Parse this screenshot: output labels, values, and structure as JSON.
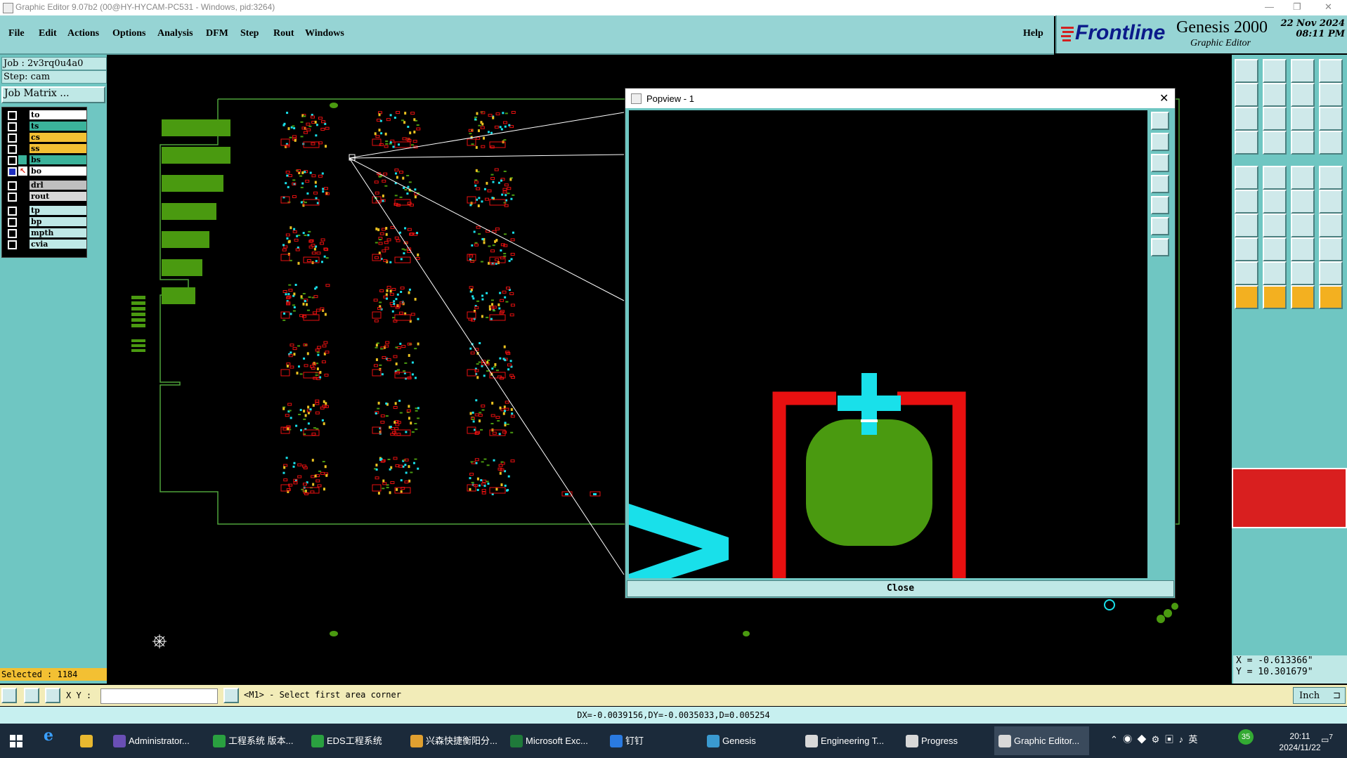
{
  "window": {
    "title": "Graphic Editor 9.07b2 (00@HY-HYCAM-PC531 - Windows, pid:3264)"
  },
  "menu": {
    "items": [
      "File",
      "Edit",
      "Actions",
      "Options",
      "Analysis",
      "DFM",
      "Step",
      "Rout",
      "Windows"
    ],
    "help": "Help"
  },
  "brand": {
    "logo": "Frontline",
    "product": "Genesis 2000",
    "subtitle": "Graphic Editor",
    "date": "22 Nov 2024",
    "time": "08:11 PM"
  },
  "job": {
    "job_label": "Job : 2v3rq0u4a0",
    "step_label": "Step: cam",
    "matrix_button": "Job Matrix ..."
  },
  "layers": [
    {
      "name": "to",
      "color": "#ffffff"
    },
    {
      "name": "ts",
      "color": "#3bb39b"
    },
    {
      "name": "cs",
      "color": "#f3c033"
    },
    {
      "name": "ss",
      "color": "#f3c033"
    },
    {
      "name": "bs",
      "color": "#3bb39b"
    },
    {
      "name": "bo",
      "color": "#ffffff"
    },
    {
      "name": "drl",
      "color": "#bfbfbf"
    },
    {
      "name": "rout",
      "color": "#d8d8d8"
    },
    {
      "name": "tp",
      "color": "#bfe8e6"
    },
    {
      "name": "bp",
      "color": "#bfe8e6"
    },
    {
      "name": "mpth",
      "color": "#bfe8e6"
    },
    {
      "name": "cvia",
      "color": "#bfe8e6"
    }
  ],
  "selected": "Selected : 1184",
  "popview": {
    "title": "Popview - 1",
    "close_label": "Close"
  },
  "coords": {
    "x": "X = -0.613366\"",
    "y": "Y = 10.301679\""
  },
  "status": {
    "xy_label": "X Y :",
    "prompt": "<M1> - Select first area corner",
    "units": "Inch",
    "delta": "DX=-0.0039156,DY=-0.0035033,D=0.005254"
  },
  "taskbar": {
    "items": [
      {
        "label": "Administrator...",
        "color": "#6a4fb5"
      },
      {
        "label": "工程系统  版本...",
        "color": "#2aa040"
      },
      {
        "label": "EDS工程系统",
        "color": "#2aa040"
      },
      {
        "label": "兴森快捷衡阳分...",
        "color": "#e0a030"
      },
      {
        "label": "Microsoft Exc...",
        "color": "#1f7a3a"
      },
      {
        "label": "钉钉",
        "color": "#2a7ae0"
      },
      {
        "label": "Genesis",
        "color": "#3a9ad0"
      },
      {
        "label": "Engineering T...",
        "color": "#d8d8d8"
      },
      {
        "label": "Progress",
        "color": "#d8d8d8"
      },
      {
        "label": "Graphic Editor...",
        "color": "#d8d8d8"
      }
    ],
    "clock_time": "20:11",
    "clock_date": "2024/11/22",
    "notify_count": "7"
  }
}
